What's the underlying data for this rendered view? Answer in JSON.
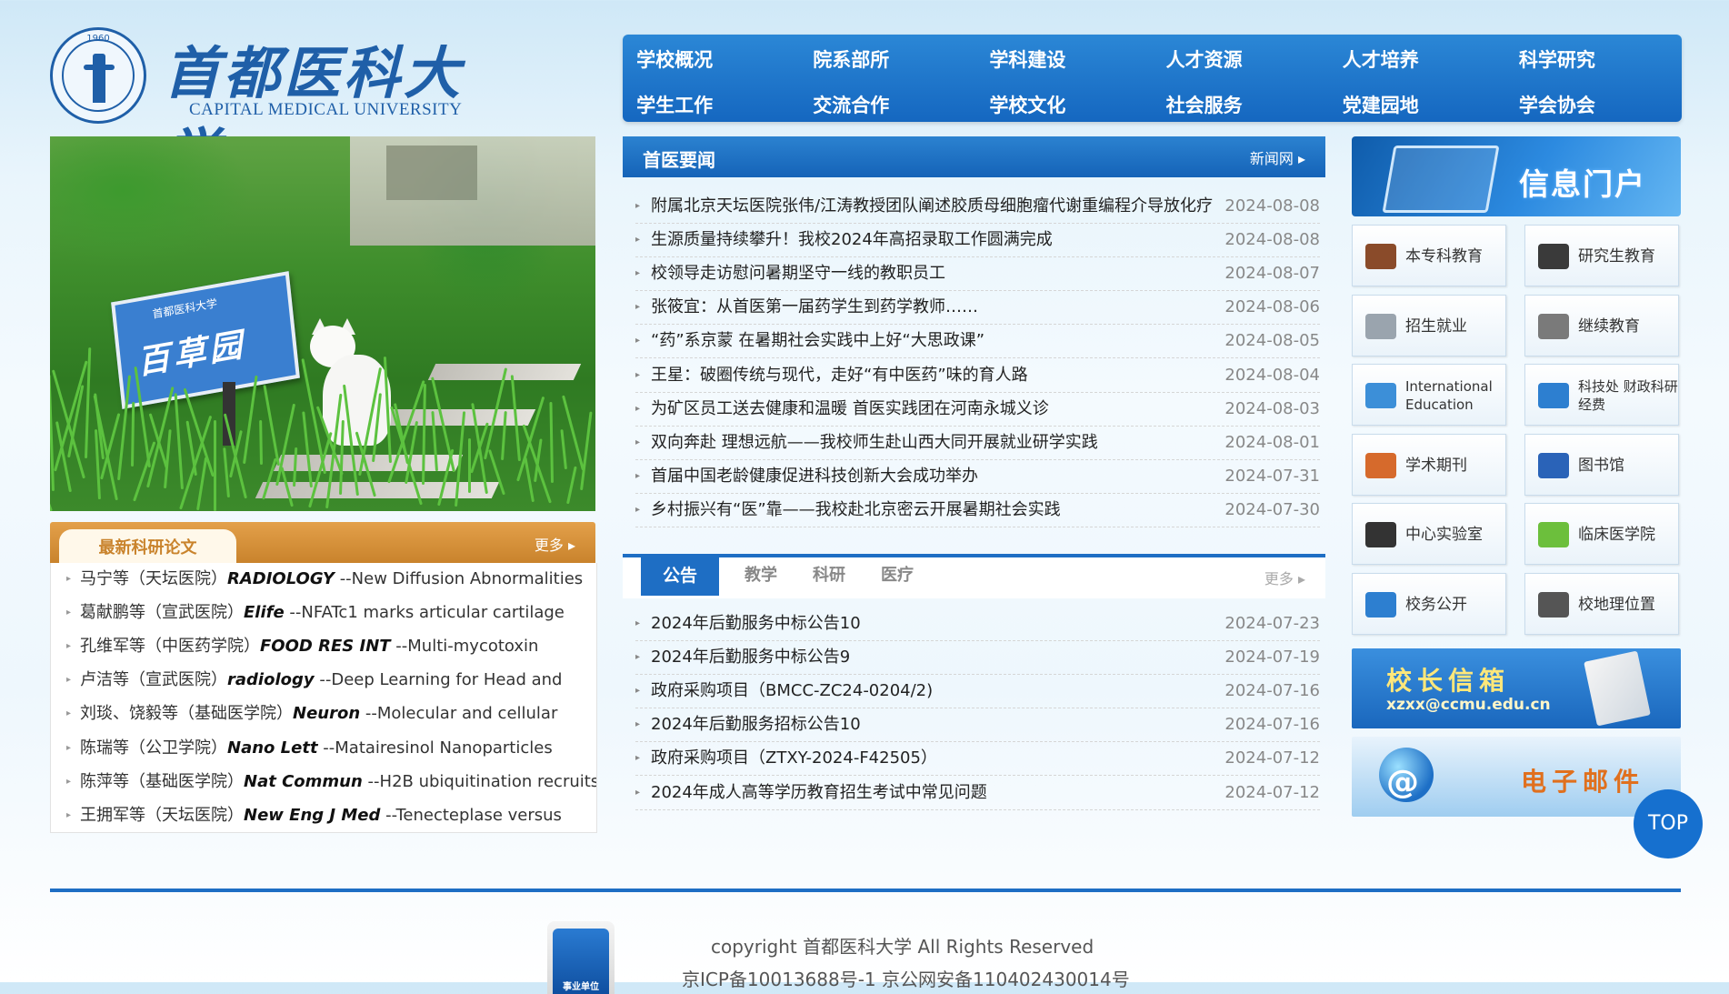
{
  "header": {
    "seal_year": "1960",
    "name_cn": "首都医科大学",
    "name_en": "CAPITAL MEDICAL UNIVERSITY"
  },
  "nav": {
    "items": [
      "学校概况",
      "院系部所",
      "学科建设",
      "人才资源",
      "人才培养",
      "科学研究",
      "学生工作",
      "交流合作",
      "学校文化",
      "社会服务",
      "党建园地",
      "学会协会"
    ]
  },
  "hero": {
    "sign_text": "百草园",
    "sign_sub": "首都医科大学"
  },
  "papers": {
    "title": "最新科研论文",
    "more": "更多",
    "items": [
      {
        "author": "马宁等（天坛医院）",
        "journal": "RADIOLOGY",
        "title": "--New Diffusion Abnormalities"
      },
      {
        "author": "葛献鹏等（宣武医院）",
        "journal": "Elife",
        "title": "--NFATc1 marks articular cartilage"
      },
      {
        "author": "孔维军等（中医药学院）",
        "journal": "FOOD RES INT",
        "title": "--Multi-mycotoxin"
      },
      {
        "author": "卢洁等（宣武医院）",
        "journal": "radiology",
        "title": "--Deep Learning for Head and"
      },
      {
        "author": "刘琰、饶毅等（基础医学院）",
        "journal": "Neuron",
        "title": "--Molecular and cellular"
      },
      {
        "author": "陈瑞等（公卫学院）",
        "journal": "Nano Lett",
        "title": "--Matairesinol Nanoparticles"
      },
      {
        "author": "陈萍等（基础医学院）",
        "journal": "Nat Commun",
        "title": "--H2B ubiquitination recruits"
      },
      {
        "author": "王拥军等（天坛医院）",
        "journal": "New Eng J Med",
        "title": "--Tenecteplase versus"
      }
    ]
  },
  "news": {
    "title": "首医要闻",
    "more": "新闻网",
    "items": [
      {
        "title": "附属北京天坛医院张伟/江涛教授团队阐述胶质母细胞瘤代谢重编程介导放化疗",
        "date": "2024-08-08"
      },
      {
        "title": "生源质量持续攀升！我校2024年高招录取工作圆满完成",
        "date": "2024-08-08"
      },
      {
        "title": "校领导走访慰问暑期坚守一线的教职员工",
        "date": "2024-08-07"
      },
      {
        "title": "张筱宜：从首医第一届药学生到药学教师……",
        "date": "2024-08-06"
      },
      {
        "title": "“药”系京蒙 在暑期社会实践中上好“大思政课”",
        "date": "2024-08-05"
      },
      {
        "title": "王星：破圈传统与现代，走好“有中医药”味的育人路",
        "date": "2024-08-04"
      },
      {
        "title": "为矿区员工送去健康和温暖 首医实践团在河南永城义诊",
        "date": "2024-08-03"
      },
      {
        "title": "双向奔赴 理想远航——我校师生赴山西大同开展就业研学实践",
        "date": "2024-08-01"
      },
      {
        "title": "首届中国老龄健康促进科技创新大会成功举办",
        "date": "2024-07-31"
      },
      {
        "title": "乡村振兴有“医”靠——我校赴北京密云开展暑期社会实践",
        "date": "2024-07-30"
      }
    ]
  },
  "notices": {
    "tabs": [
      "公告",
      "教学",
      "科研",
      "医疗"
    ],
    "more": "更多",
    "items": [
      {
        "title": "2024年后勤服务中标公告10",
        "date": "2024-07-23"
      },
      {
        "title": "2024年后勤服务中标公告9",
        "date": "2024-07-19"
      },
      {
        "title": "政府采购项目（BMCC-ZC24-0204/2)",
        "date": "2024-07-16"
      },
      {
        "title": "2024年后勤服务招标公告10",
        "date": "2024-07-16"
      },
      {
        "title": "政府采购项目（ZTXY-2024-F42505）",
        "date": "2024-07-12"
      },
      {
        "title": "2024年成人高等学历教育招生考试中常见问题",
        "date": "2024-07-12"
      }
    ]
  },
  "portal": {
    "title": "信息门户",
    "links": [
      {
        "label": "本专科教育",
        "icon": "books-icon",
        "color": "#8a4b2a"
      },
      {
        "label": "研究生教育",
        "icon": "graduation-cap-icon",
        "color": "#3a3a3a"
      },
      {
        "label": "招生就业",
        "icon": "documents-icon",
        "color": "#9aa4ae"
      },
      {
        "label": "继续教育",
        "icon": "open-book-icon",
        "color": "#7a7a7a"
      },
      {
        "label": "International Education",
        "icon": "globe-icon",
        "color": "#3c8fd8"
      },
      {
        "label": "科技处 财政科研经费",
        "icon": "certificate-icon",
        "color": "#2d7fd0"
      },
      {
        "label": "学术期刊",
        "icon": "journal-icon",
        "color": "#d66a2c"
      },
      {
        "label": "图书馆",
        "icon": "library-icon",
        "color": "#2a63b8"
      },
      {
        "label": "中心实验室",
        "icon": "microscope-icon",
        "color": "#333333"
      },
      {
        "label": "临床医学院",
        "icon": "medical-cross-icon",
        "color": "#6cbf3c"
      },
      {
        "label": "校务公开",
        "icon": "monitor-icon",
        "color": "#2d7fd0"
      },
      {
        "label": "校地理位置",
        "icon": "map-pin-icon",
        "color": "#555555"
      }
    ],
    "mailbox_title": "校长信箱",
    "mailbox_email": "xzxx@ccmu.edu.cn",
    "email_title": "电子邮件"
  },
  "top_button": "TOP",
  "footer": {
    "badge_text": "事业单位",
    "copyright": "copyright 首都医科大学 All Rights Reserved",
    "icp": "京ICP备10013688号-1 京公网安备110402430014号"
  },
  "colors": {
    "primary": "#1e6ec4",
    "accent_orange": "#c9832c"
  }
}
